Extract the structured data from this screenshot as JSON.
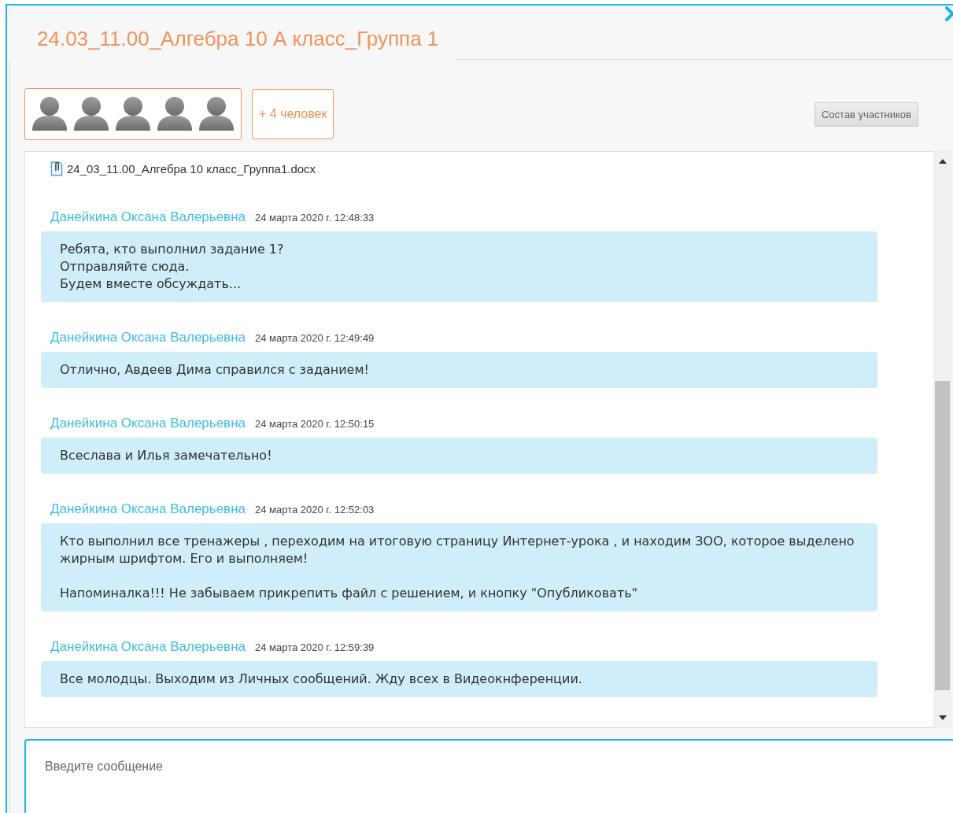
{
  "dialog": {
    "title": "24.03_11.00_Алгебра 10 А класс_Группа 1"
  },
  "participants": {
    "avatars": [
      {
        "kind": "person"
      },
      {
        "kind": "person"
      },
      {
        "kind": "person"
      },
      {
        "kind": "person"
      },
      {
        "kind": "person"
      }
    ],
    "more": "+ 4 человек",
    "members_button": "Состав участников"
  },
  "attachment": {
    "file_name": "24_03_11.00_Алгебра 10 класс_Группа1.docx"
  },
  "messages": [
    {
      "author": "Данейкина Оксана Валерьевна",
      "time": "24 марта 2020 г. 12:48:33",
      "text": "Ребята, кто выполнил задание 1?\nОтправляйте сюда.\nБудем вместе обсуждать..."
    },
    {
      "author": "Данейкина Оксана Валерьевна",
      "time": "24 марта 2020 г. 12:49:49",
      "text": "Отлично, Авдеев Дима справился с заданием!"
    },
    {
      "author": "Данейкина Оксана Валерьевна",
      "time": "24 марта 2020 г. 12:50:15",
      "text": "Всеслава и Илья замечательно!"
    },
    {
      "author": "Данейкина Оксана Валерьевна",
      "time": "24 марта 2020 г. 12:52:03",
      "text": "Кто выполнил все тренажеры , переходим на итоговую страницу Интернет-урока , и находим ЗОО, которое выделено жирным шрифтом. Его и выполняем!\n\nНапоминалка!!! Не забываем прикрепить файл с решением, и кнопку \"Опубликовать\""
    },
    {
      "author": "Данейкина Оксана Валерьевна",
      "time": "24 марта 2020 г. 12:59:39",
      "text": "Все молодцы. Выходим из Личных сообщений. Жду всех в Видеокнференции."
    }
  ],
  "composer": {
    "placeholder": "Введите сообщение"
  }
}
